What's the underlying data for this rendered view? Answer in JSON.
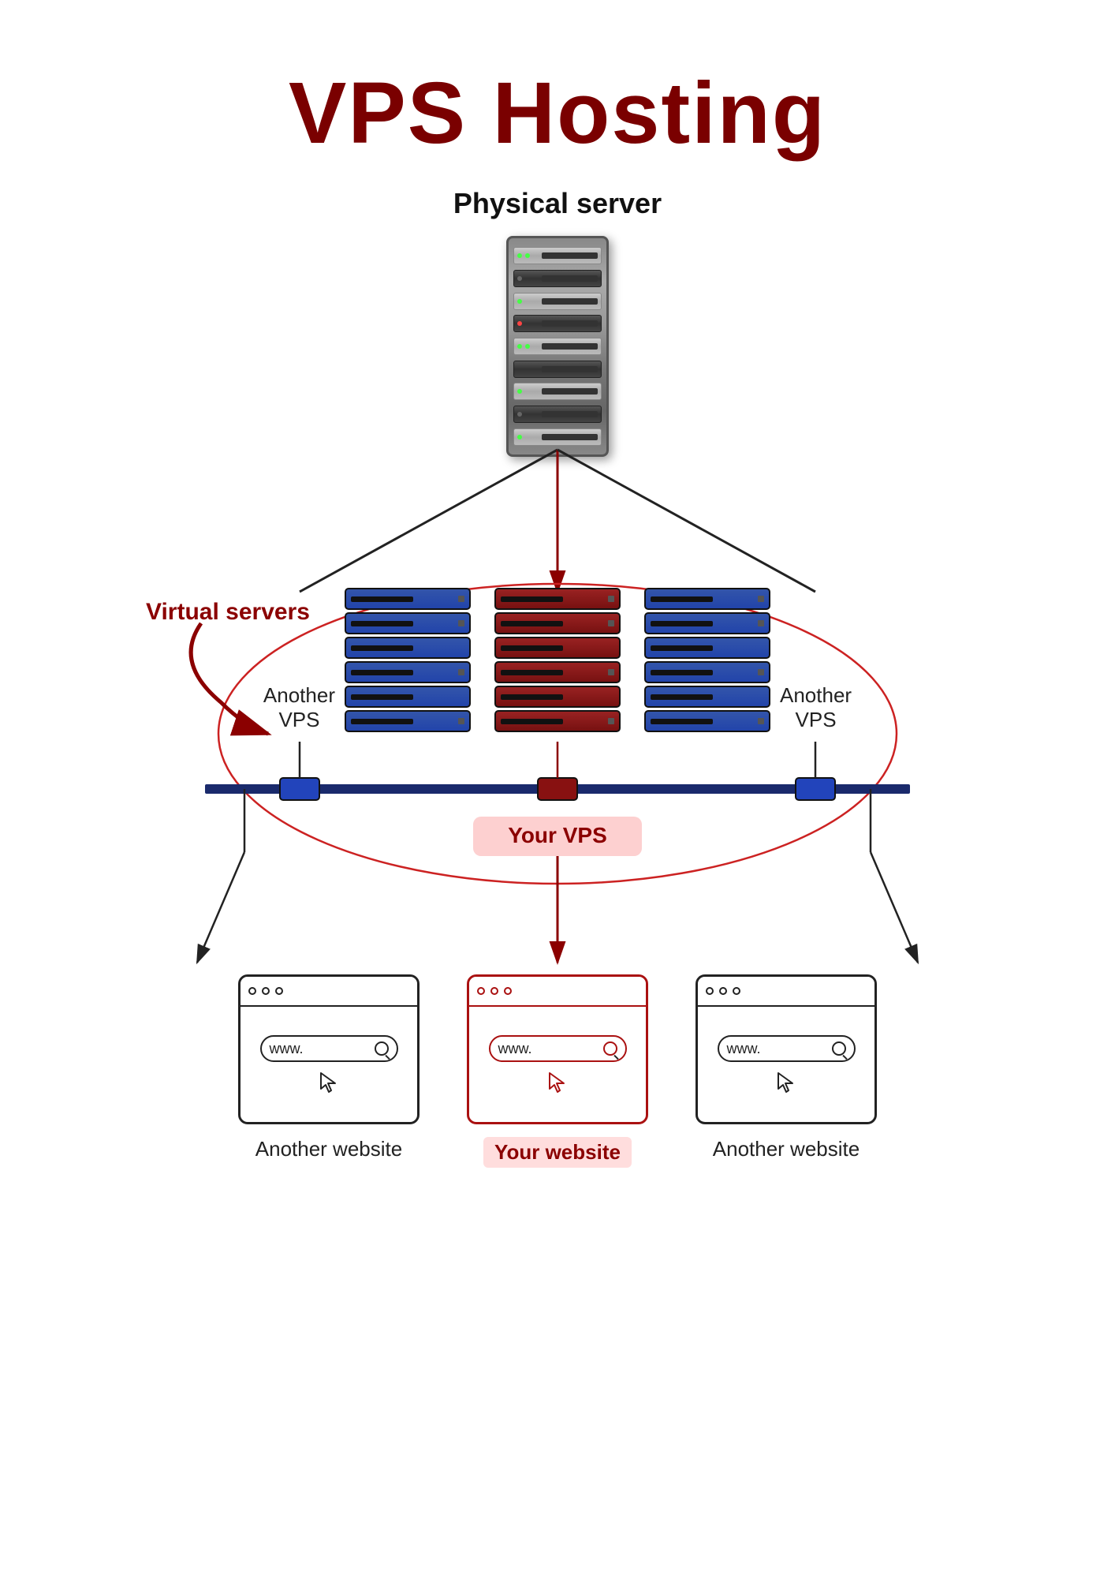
{
  "title": "VPS Hosting",
  "physical_server_label": "Physical server",
  "virtual_servers_label": "Virtual servers",
  "your_vps_label": "Your VPS",
  "another_vps_label": "Another\nVPS",
  "your_website_label": "Your website",
  "another_website_label": "Another website",
  "www_text": "www.",
  "colors": {
    "dark_red": "#7a0000",
    "medium_red": "#8b0000",
    "blue_vps": "#2244aa",
    "red_vps": "#882222",
    "highlight_bg": "#fdd0d0",
    "text_dark": "#222222",
    "border_dark": "#222222"
  }
}
